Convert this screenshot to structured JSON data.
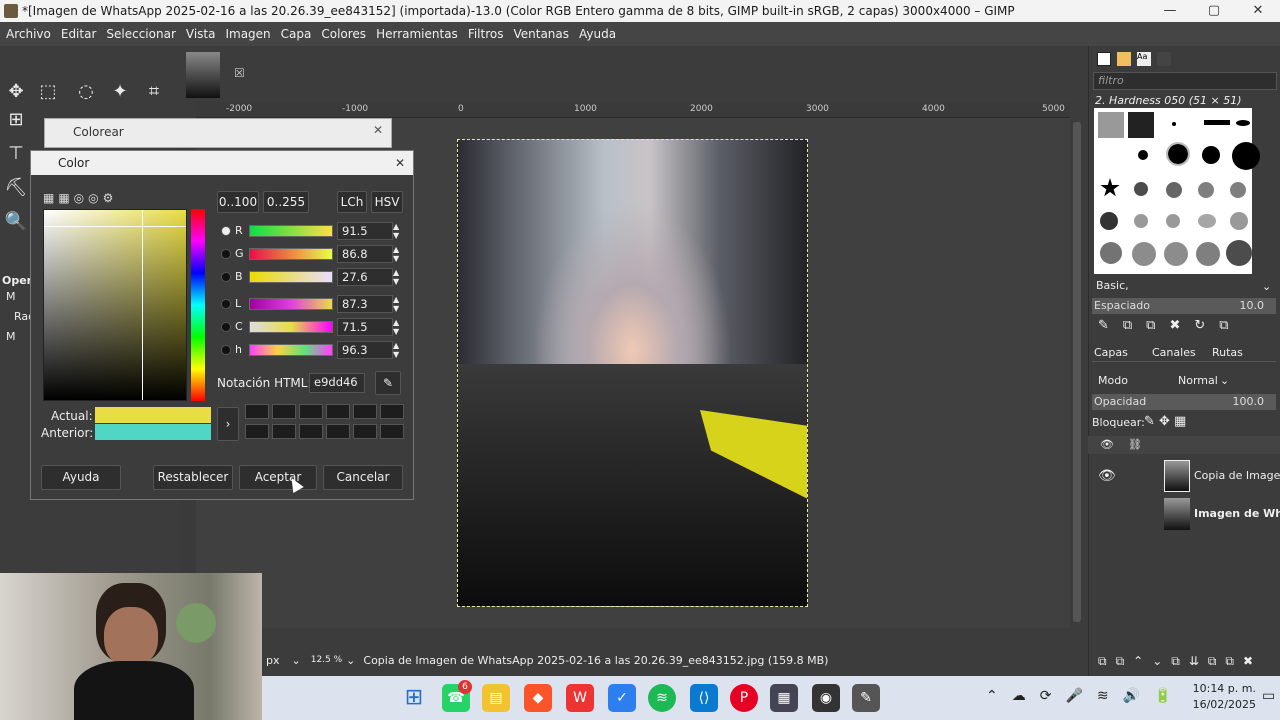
{
  "window": {
    "title": "*[Imagen de WhatsApp 2025-02-16 a las 20.26.39_ee843152] (importada)-13.0 (Color RGB Entero gamma de 8 bits, GIMP built-in sRGB, 2 capas) 3000x4000 – GIMP"
  },
  "menu": [
    "Archivo",
    "Editar",
    "Seleccionar",
    "Vista",
    "Imagen",
    "Capa",
    "Colores",
    "Herramientas",
    "Filtros",
    "Ventanas",
    "Ayuda"
  ],
  "ruler": {
    "h_labels": [
      "-2000",
      "-1000",
      "0",
      "1000",
      "2000",
      "3000",
      "4000",
      "5000"
    ]
  },
  "colorear_dialog": {
    "title": "Colorear"
  },
  "color_dialog": {
    "title": "Color",
    "range_buttons": [
      "0..100",
      "0..255"
    ],
    "mode_buttons": [
      "LCh",
      "HSV"
    ],
    "channels": [
      {
        "label": "R",
        "value": "91.5"
      },
      {
        "label": "G",
        "value": "86.8"
      },
      {
        "label": "B",
        "value": "27.6"
      },
      {
        "label": "L",
        "value": "87.3"
      },
      {
        "label": "C",
        "value": "71.5"
      },
      {
        "label": "h",
        "value": "96.3"
      }
    ],
    "html_label": "Notación HTML:",
    "html_value": "e9dd46",
    "actual_label": "Actual:",
    "anterior_label": "Anterior:",
    "actual_color": "#e9dd46",
    "anterior_color": "#4fd6c4",
    "buttons": {
      "help": "Ayuda",
      "reset": "Restablecer",
      "ok": "Aceptar",
      "cancel": "Cancelar"
    }
  },
  "left_panel": {
    "oper": "Oper",
    "m1": "M",
    "rad": "Rad",
    "m2": "M"
  },
  "statusbar": {
    "unit": "px",
    "zoom": "12.5 %",
    "info": "Copia de Imagen de WhatsApp 2025-02-16 a las 20.26.39_ee843152.jpg (159.8 MB)"
  },
  "right_dock": {
    "filter_placeholder": "filtro",
    "brush_name": "2. Hardness 050 (51 × 51)",
    "preset": "Basic,",
    "spacing_label": "Espaciado",
    "spacing_value": "10.0",
    "tabs": [
      "Capas",
      "Canales",
      "Rutas"
    ],
    "mode_label": "Modo",
    "mode_value": "Normal",
    "opacity_label": "Opacidad",
    "opacity_value": "100.0",
    "lock_label": "Bloquear:",
    "layers": [
      {
        "name": "Copia de Imagen d"
      },
      {
        "name": "Imagen de Wha"
      }
    ]
  },
  "taskbar": {
    "badge": "6",
    "time": "10:14 p. m.",
    "date": "16/02/2025"
  }
}
